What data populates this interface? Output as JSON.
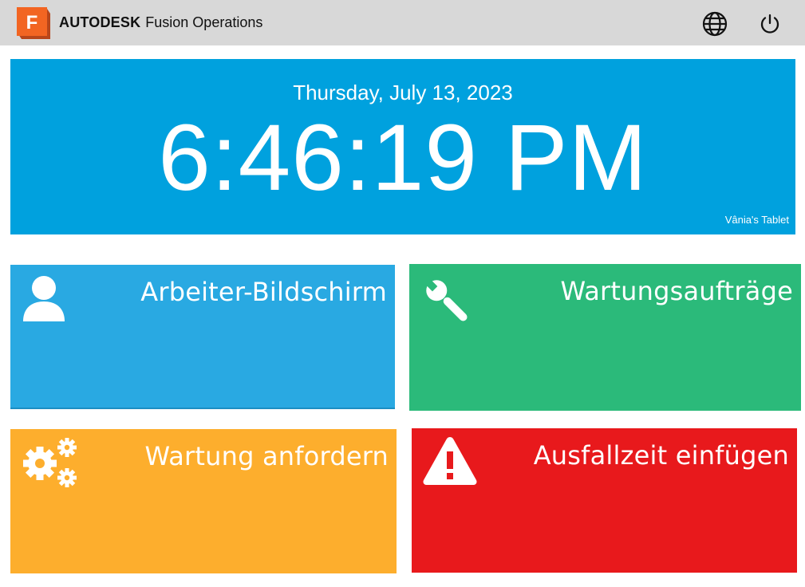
{
  "header": {
    "logo_letter": "F",
    "brand_strong": "AUTODESK",
    "brand_product": "Fusion Operations",
    "icons": [
      "globe-icon",
      "power-icon"
    ],
    "colors": {
      "bar": "#d8d8d8",
      "logo_orange": "#f26522"
    }
  },
  "clock": {
    "date": "Thursday, July 13, 2023",
    "time": "6:46:19 PM",
    "device": "Vânia's Tablet",
    "color": "#00a1de"
  },
  "tiles": [
    {
      "label": "Arbeiter-Bildschirm",
      "icon": "worker-icon",
      "color": "#29a9e2"
    },
    {
      "label": "Wartungsaufträge",
      "icon": "wrench-icon",
      "color": "#2bba7a"
    },
    {
      "label": "Wartung anfordern",
      "icon": "gears-icon",
      "color": "#fdae2d"
    },
    {
      "label": "Ausfallzeit einfügen",
      "icon": "warning-icon",
      "color": "#e8191c"
    }
  ]
}
